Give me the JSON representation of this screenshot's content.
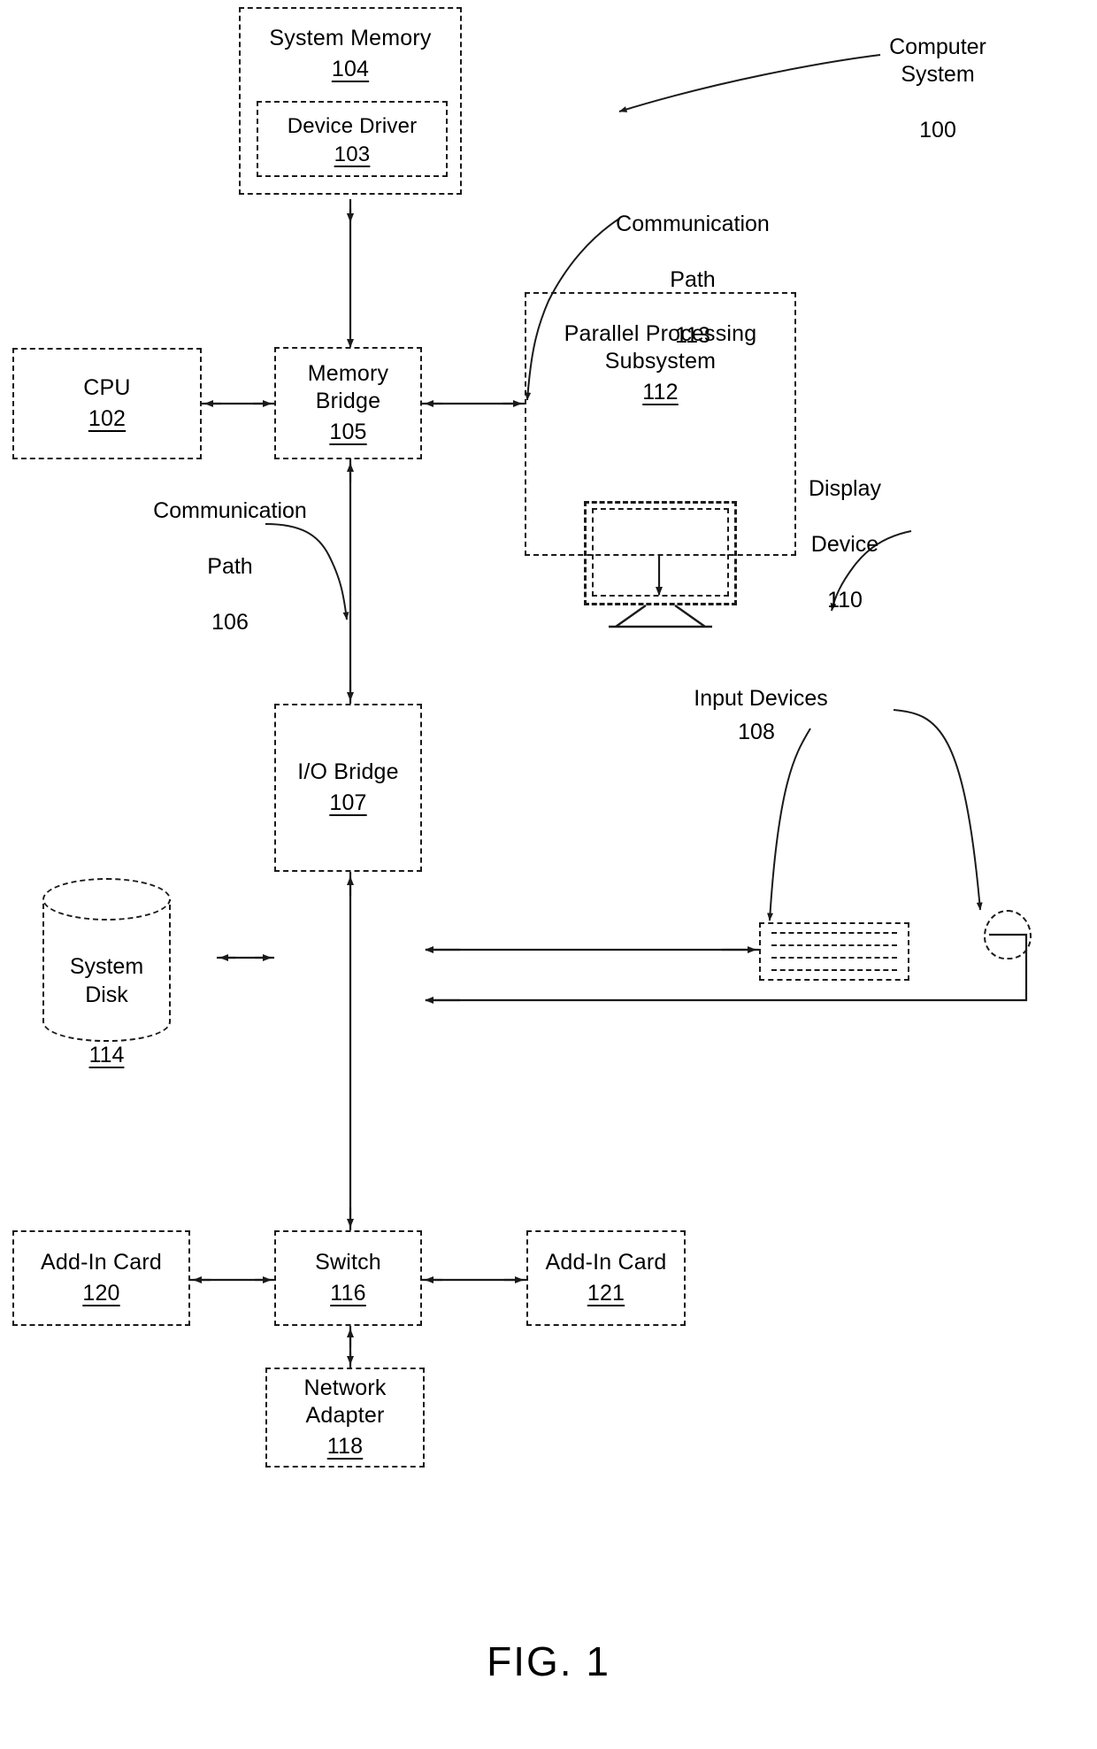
{
  "figure": {
    "caption": "FIG. 1",
    "title_label": "Computer System",
    "title_number": "100"
  },
  "blocks": {
    "system_memory": {
      "title": "System Memory",
      "number": "104"
    },
    "device_driver": {
      "title": "Device Driver",
      "number": "103"
    },
    "cpu": {
      "title": "CPU",
      "number": "102"
    },
    "memory_bridge": {
      "title": "Memory\nBridge",
      "number": "105"
    },
    "parallel_processing_subsystem": {
      "title": "Parallel Processing\nSubsystem",
      "number": "112"
    },
    "io_bridge": {
      "title": "I/O Bridge",
      "number": "107"
    },
    "system_disk": {
      "title": "System\nDisk",
      "number": "114"
    },
    "switch": {
      "title": "Switch",
      "number": "116"
    },
    "add_in_card_120": {
      "title": "Add-In Card",
      "number": "120"
    },
    "add_in_card_121": {
      "title": "Add-In Card",
      "number": "121"
    },
    "network_adapter": {
      "title": "Network\nAdapter",
      "number": "118"
    }
  },
  "annotations": {
    "communication_path_113": {
      "line1": "Communication",
      "line2": "Path",
      "number": "113"
    },
    "communication_path_106": {
      "line1": "Communication",
      "line2": "Path",
      "number": "106"
    },
    "display_device": {
      "line1": "Display",
      "line2": "Device",
      "number": "110"
    },
    "input_devices": {
      "line1": "Input Devices",
      "number": "108"
    }
  },
  "peripherals": {
    "display_device_icon": "monitor-icon",
    "keyboard_icon": "keyboard-icon",
    "mouse_icon": "mouse-icon"
  },
  "style": {
    "ink": "#1a1a1a",
    "paper": "#ffffff"
  }
}
